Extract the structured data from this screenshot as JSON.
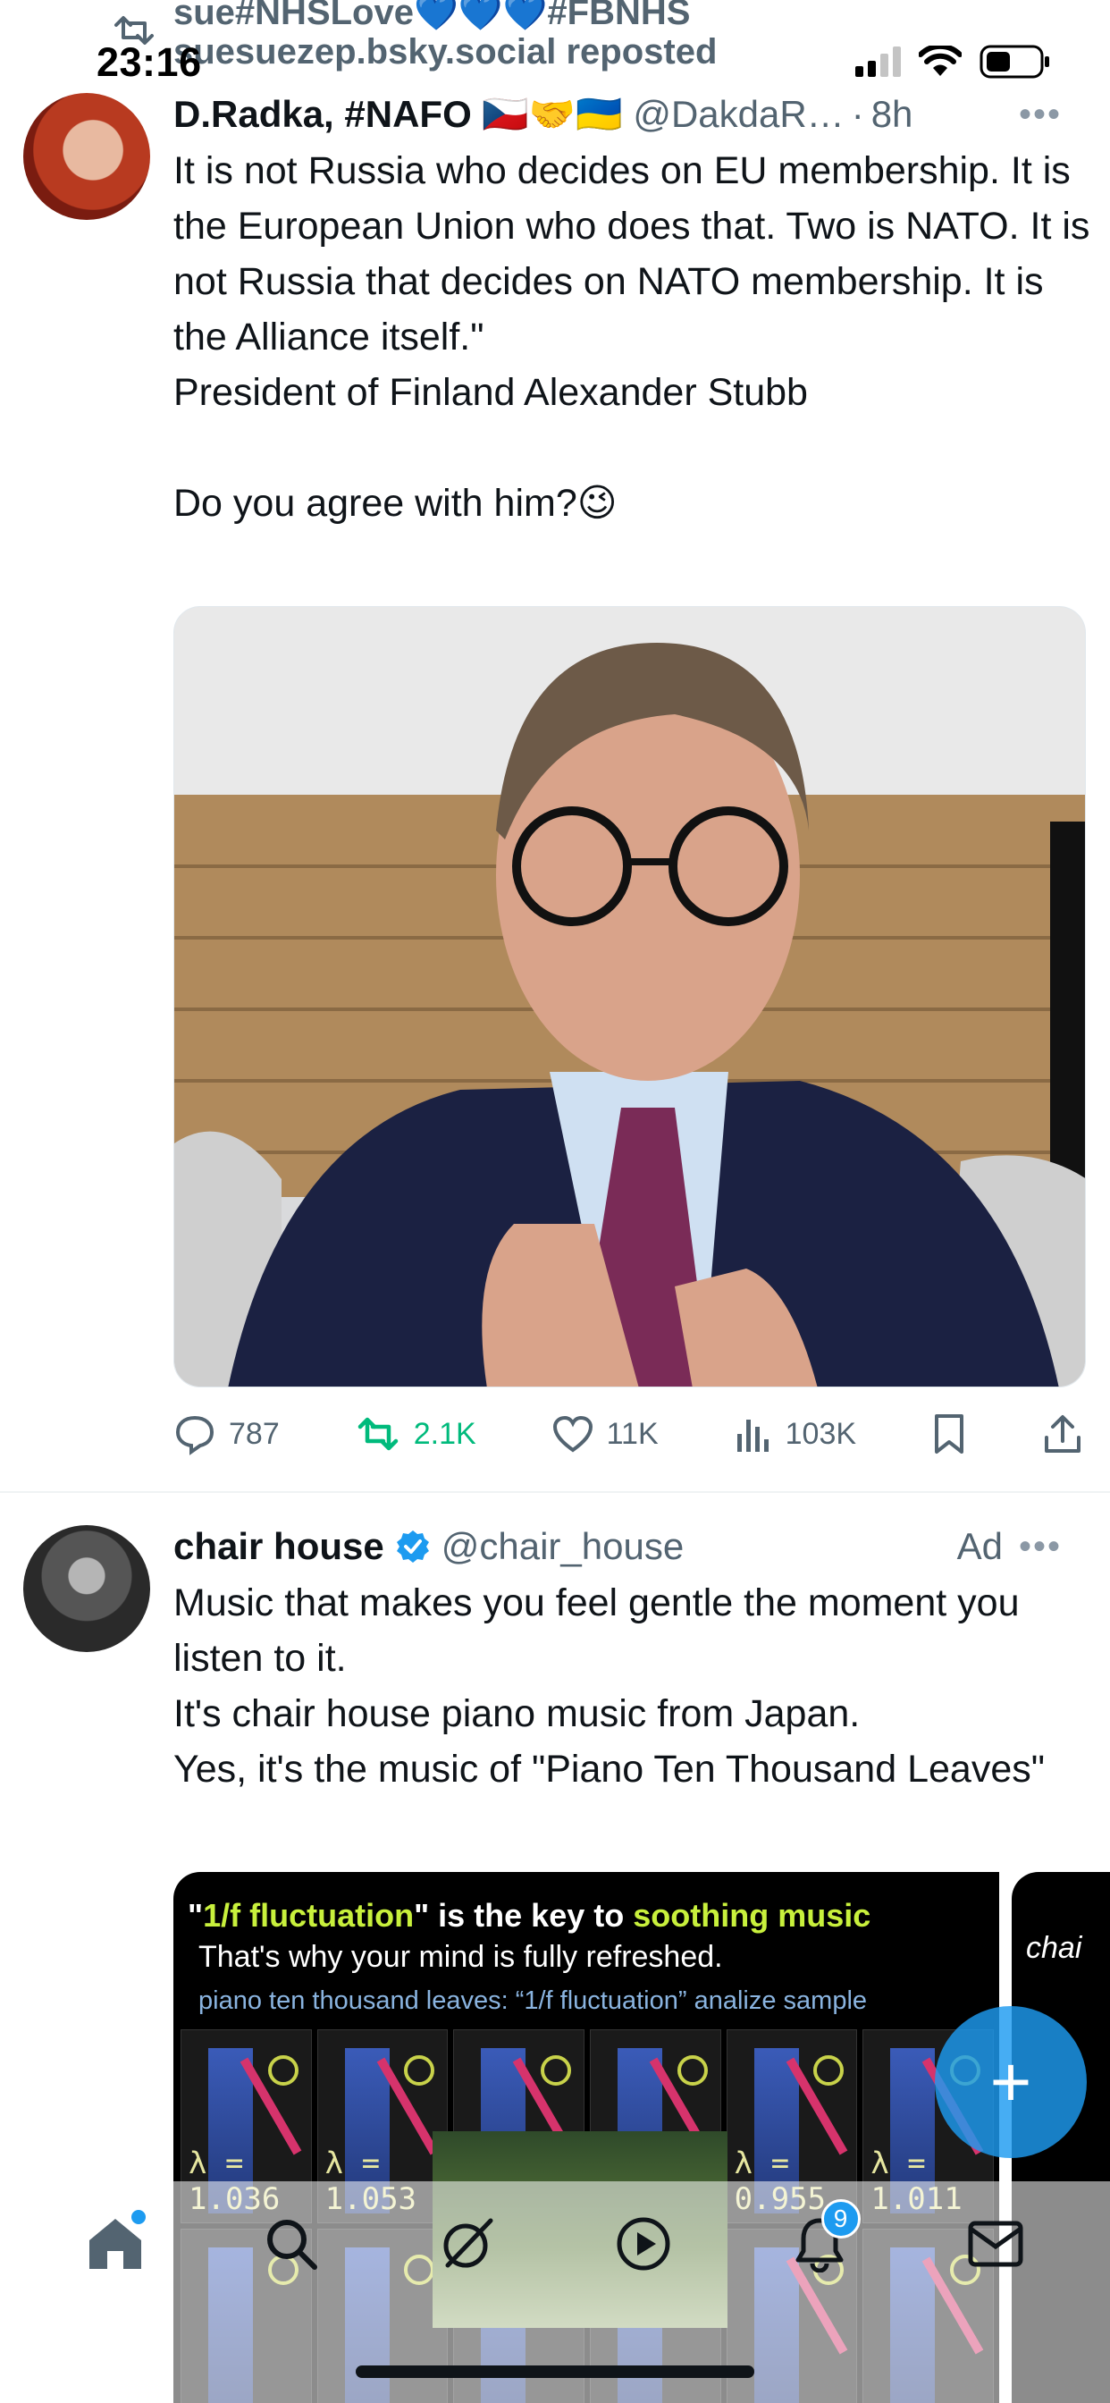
{
  "status_bar": {
    "time": "23:16"
  },
  "repost_context": {
    "line1": "sue#NHSLove💙💙💙#FBNHS",
    "line2": "suesuezep.bsky.social reposted"
  },
  "post1": {
    "author": "D.Radka, #NAFO 🇨🇿🤝🇺🇦",
    "handle": "@DakdaR…",
    "time": "8h",
    "text": "It is not Russia who decides on EU membership. It is the European Union who does that. Two is NATO. It is not Russia that decides on NATO membership. It is the Alliance itself.\"\nPresident of Finland Alexander Stubb\n\nDo you agree with him?😉",
    "stats": {
      "replies": "787",
      "reposts": "2.1K",
      "likes": "11K",
      "views": "103K"
    }
  },
  "post2": {
    "author": "chair house",
    "handle": "@chair_house",
    "ad_label": "Ad",
    "text": "Music that makes you feel gentle the moment you listen to it.\nIt's chair house piano music from Japan.\nYes, it's the music of \"Piano Ten Thousand Leaves\"",
    "media": {
      "line1_a": "\"",
      "line1_hl1": "1/f fluctuation",
      "line1_b": "\" is the key to ",
      "line1_hl2": "soothing music",
      "line2": "That's why your mind is fully refreshed.",
      "line3": "piano ten thousand leaves: “1/f fluctuation” analize sample",
      "lambdas": [
        "λ = 1.036",
        "λ = 1.053",
        "",
        "",
        "λ = 0.955",
        "λ = 1.011"
      ],
      "side_text": "chai"
    }
  },
  "fab": {
    "label": "+"
  },
  "tabbar": {
    "notifications_badge": "9"
  },
  "colors": {
    "accent": "#1d9bf0",
    "repost_green": "#00ba7c",
    "muted": "#536471"
  }
}
